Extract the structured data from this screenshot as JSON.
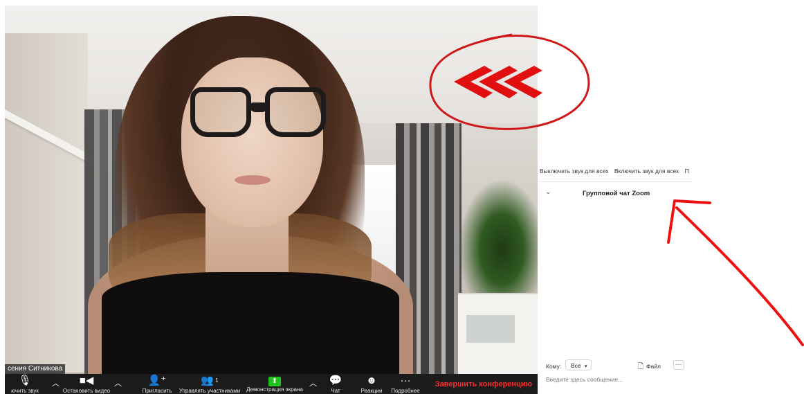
{
  "video": {
    "participant_name": "сения Ситникова"
  },
  "toolbar": {
    "mute": {
      "label": "ючить звук",
      "icon": "microphone-icon"
    },
    "video": {
      "label": "Остановить видео",
      "icon": "video-camera-icon"
    },
    "invite": {
      "label": "Пригласить",
      "icon": "invite-person-icon"
    },
    "participants": {
      "label": "Управлять участниками",
      "icon": "participants-icon",
      "count": "1"
    },
    "share": {
      "label": "Демонстрация экрана",
      "icon": "share-screen-icon"
    },
    "chat": {
      "label": "Чат",
      "icon": "chat-bubble-icon"
    },
    "reactions": {
      "label": "Реакции",
      "icon": "reaction-emoji-icon"
    },
    "more": {
      "label": "Подробнее",
      "icon": "more-dots-icon"
    },
    "end": {
      "label": "Завершить конференцию"
    }
  },
  "participants_panel": {
    "buttons": [
      "Выключить звук для всех",
      "Включить звук для всех",
      "П"
    ]
  },
  "chat": {
    "title": "Групповой чат Zoom",
    "to_label": "Кому:",
    "recipient": "Все",
    "file_label": "Файл",
    "more_label": "···",
    "input_placeholder": "Введите здесь сообщение..."
  },
  "annotation": {
    "color": "#e01010"
  }
}
